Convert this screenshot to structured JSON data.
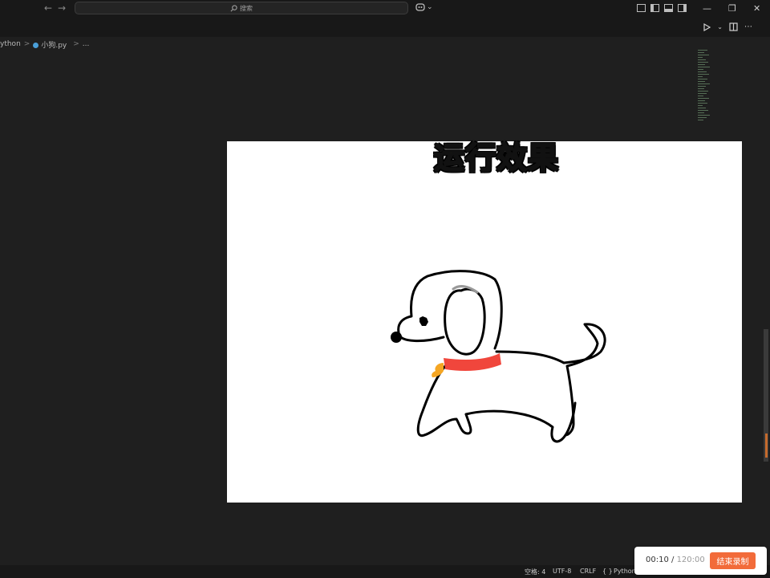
{
  "titlebar": {
    "back_icon": "arrow-left-icon",
    "forward_icon": "arrow-right-icon",
    "search_placeholder": "搜索",
    "copilot_icon": "copilot-icon",
    "window_controls": [
      "minimize",
      "restore",
      "close"
    ]
  },
  "breadcrumb": {
    "items": [
      "ython",
      "小狗.py",
      "..."
    ],
    "separator": ">"
  },
  "preview": {
    "caption": "运行效果",
    "caption_color": "#ffd600",
    "collar_color": "#f0463c",
    "tag_color": "#f5a623"
  },
  "statusbar": {
    "spaces": "空格: 4",
    "encoding": "UTF-8",
    "eol": "CRLF",
    "language": "Python"
  },
  "recorder": {
    "elapsed": "00:10",
    "divider": " / ",
    "limit": "120:00",
    "stop_label": "结束录制",
    "accent": "#f26b3a"
  }
}
